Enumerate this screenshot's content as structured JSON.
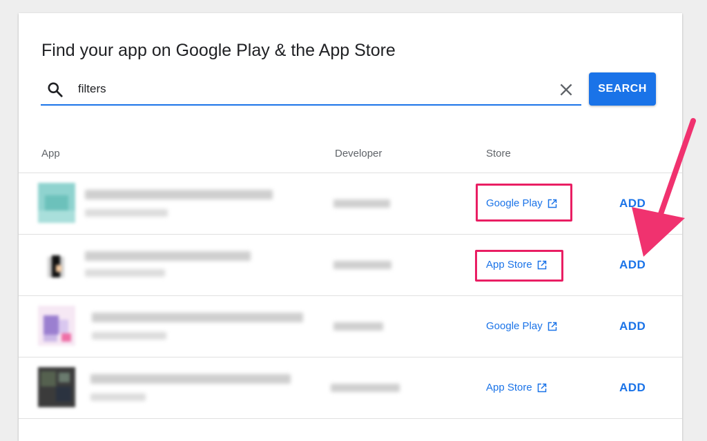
{
  "page": {
    "title": "Find your app on Google Play & the App Store"
  },
  "search": {
    "value": "filters",
    "button_label": "SEARCH"
  },
  "table": {
    "headers": {
      "app": "App",
      "developer": "Developer",
      "store": "Store"
    },
    "rows": [
      {
        "store": "Google Play",
        "action": "ADD"
      },
      {
        "store": "App Store",
        "action": "ADD"
      },
      {
        "store": "Google Play",
        "action": "ADD"
      },
      {
        "store": "App Store",
        "action": "ADD"
      }
    ]
  },
  "colors": {
    "accent": "#1a73e8",
    "annotation": "#e91e63"
  },
  "icons": {
    "search": "search-icon",
    "clear": "close-icon",
    "external": "external-link-icon"
  }
}
